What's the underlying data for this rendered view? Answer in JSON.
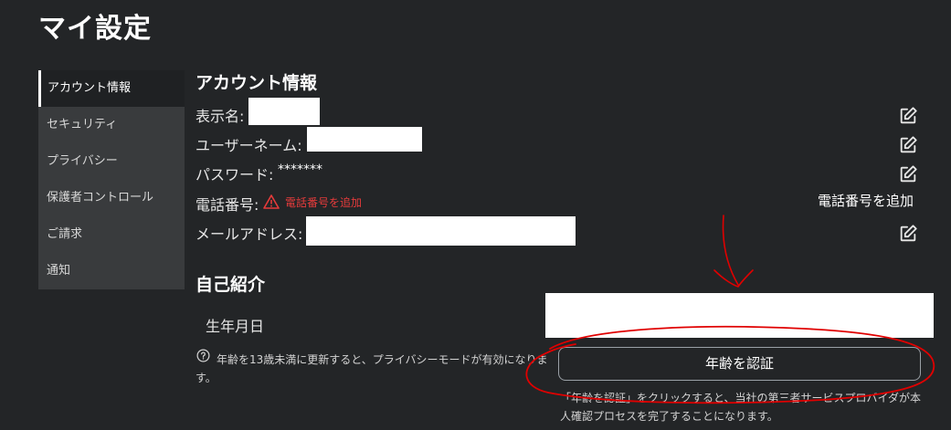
{
  "page": {
    "title": "マイ設定"
  },
  "sidebar": {
    "items": [
      {
        "label": "アカウント情報",
        "active": true
      },
      {
        "label": "セキュリティ"
      },
      {
        "label": "プライバシー"
      },
      {
        "label": "保護者コントロール"
      },
      {
        "label": "ご請求"
      },
      {
        "label": "通知"
      }
    ]
  },
  "account": {
    "section_title": "アカウント情報",
    "display_name_label": "表示名:",
    "username_label": "ユーザーネーム:",
    "password_label": "パスワード:",
    "password_value": "*******",
    "phone_label": "電話番号:",
    "phone_warning": "電話番号を追加",
    "phone_add_button": "電話番号を追加",
    "email_label": "メールアドレス:"
  },
  "about": {
    "section_title": "自己紹介",
    "birthday_label": "生年月日",
    "privacy_note": "年齢を13歳未満に更新すると、プライバシーモードが有効になります。",
    "verify_age_button": "年齢を認証",
    "verify_note": "「年齢を認証」をクリックすると、当社の第三者サービスプロバイダが本人確認プロセスを完了することになります。"
  },
  "colors": {
    "background": "#232527",
    "sidebar": "#393b3d",
    "warning": "#e63b3b",
    "annotation": "#e00000"
  },
  "icons": {
    "edit": "edit-icon",
    "warning": "warning-triangle-icon",
    "help": "help-circle-icon"
  }
}
